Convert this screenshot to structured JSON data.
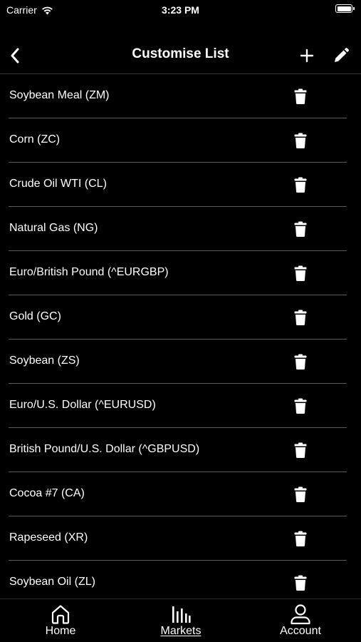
{
  "status_bar": {
    "carrier": "Carrier",
    "time": "3:23 PM",
    "battery_level_percent": 100
  },
  "nav": {
    "title": "Customise List",
    "back_icon": "chevron-left-icon",
    "add_icon": "plus-icon",
    "edit_icon": "pencil-icon"
  },
  "list": {
    "items": [
      {
        "label": "Soybean Meal (ZM)"
      },
      {
        "label": "Corn (ZC)"
      },
      {
        "label": "Crude Oil WTI (CL)"
      },
      {
        "label": "Natural Gas (NG)"
      },
      {
        "label": "Euro/British Pound (^EURGBP)"
      },
      {
        "label": "Gold (GC)"
      },
      {
        "label": "Soybean (ZS)"
      },
      {
        "label": "Euro/U.S. Dollar (^EURUSD)"
      },
      {
        "label": "British Pound/U.S. Dollar (^GBPUSD)"
      },
      {
        "label": "Cocoa #7 (CA)"
      },
      {
        "label": "Rapeseed (XR)"
      },
      {
        "label": "Soybean Oil (ZL)"
      }
    ],
    "delete_icon": "trash-icon"
  },
  "tab_bar": {
    "tabs": [
      {
        "label": "Home",
        "icon": "home-icon",
        "active": false
      },
      {
        "label": "Markets",
        "icon": "bar-chart-icon",
        "active": true
      },
      {
        "label": "Account",
        "icon": "user-icon",
        "active": false
      }
    ]
  },
  "colors": {
    "background": "#000000",
    "text": "#ffffff",
    "divider": "#5a5a5a"
  }
}
